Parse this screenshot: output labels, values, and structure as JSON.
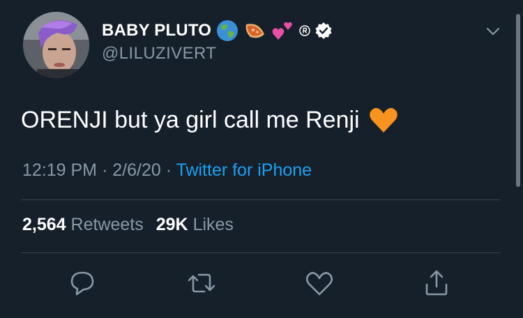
{
  "author": {
    "display_name": "BABY PLUTO",
    "handle": "@LILUZIVERT",
    "avatar_icon": "avatar-photo",
    "name_badges": [
      "globe-emoji",
      "pastry-emoji",
      "two-hearts-emoji",
      "registered-symbol",
      "verified-badge"
    ]
  },
  "tweet": {
    "text": "ORENJI but ya girl call me Renji",
    "emoji": "orange-heart-emoji",
    "time": "12:19 PM",
    "date": "2/6/20",
    "separator": "·",
    "source": "Twitter for iPhone"
  },
  "stats": {
    "retweets_count": "2,564",
    "retweets_label": "Retweets",
    "likes_count": "29K",
    "likes_label": "Likes"
  },
  "actions": [
    "reply-icon",
    "retweet-icon",
    "like-icon",
    "share-icon"
  ],
  "colors": {
    "background": "#15202b",
    "secondary_text": "#8899a6",
    "link": "#1da1f2",
    "divider": "#38444d",
    "orange_heart": "#f7931e"
  }
}
